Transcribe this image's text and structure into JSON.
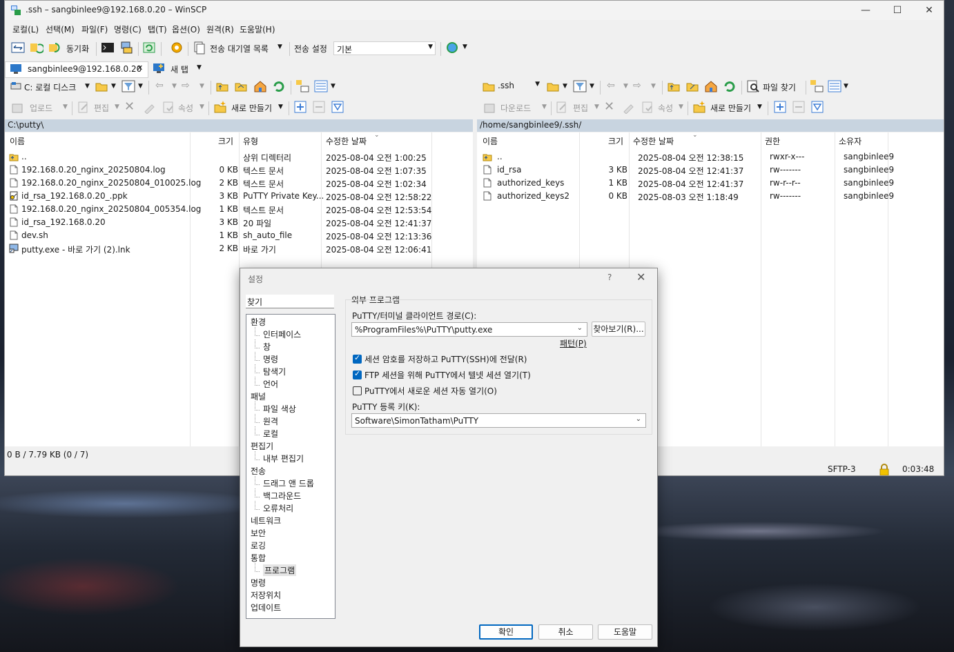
{
  "window": {
    "title": ".ssh – sangbinlee9@192.168.0.20 – WinSCP",
    "controls": {
      "minimize": "—",
      "maximize": "☐",
      "close": "✕"
    }
  },
  "menu": [
    "로컬(L)",
    "선택(M)",
    "파일(F)",
    "명령(C)",
    "탭(T)",
    "옵션(O)",
    "원격(R)",
    "도움말(H)"
  ],
  "toolbar": {
    "sync_label": "동기화",
    "queue_label": "전송 대기열 목록",
    "transfer_settings_label": "전송 설정",
    "transfer_settings_value": "기본"
  },
  "tabs": {
    "session": "sangbinlee9@192.168.0.20",
    "new_tab": "새 탭"
  },
  "local": {
    "drive": "C: 로컬 디스크",
    "upload": "업로드",
    "edit": "편집",
    "properties": "속성",
    "new": "새로 만들기",
    "path": "C:\\putty\\",
    "columns": [
      "이름",
      "크기",
      "유형",
      "수정한 날짜"
    ],
    "files": [
      {
        "name": "..",
        "size": "",
        "type": "상위 디렉터리",
        "date": "2025-08-04 오전 1:00:25",
        "icon": "folder-up-icon"
      },
      {
        "name": "192.168.0.20_nginx_20250804.log",
        "size": "0 KB",
        "type": "텍스트 문서",
        "date": "2025-08-04 오전 1:07:35",
        "icon": "file-icon"
      },
      {
        "name": "192.168.0.20_nginx_20250804_010025.log",
        "size": "2 KB",
        "type": "텍스트 문서",
        "date": "2025-08-04 오전 1:02:34",
        "icon": "file-icon"
      },
      {
        "name": "id_rsa_192.168.0.20_.ppk",
        "size": "3 KB",
        "type": "PuTTY Private Key...",
        "date": "2025-08-04 오전 12:58:22",
        "icon": "key-file-icon"
      },
      {
        "name": "192.168.0.20_nginx_20250804_005354.log",
        "size": "1 KB",
        "type": "텍스트 문서",
        "date": "2025-08-04 오전 12:53:54",
        "icon": "file-icon"
      },
      {
        "name": "id_rsa_192.168.0.20",
        "size": "3 KB",
        "type": "20 파일",
        "date": "2025-08-04 오전 12:41:37",
        "icon": "file-icon"
      },
      {
        "name": "dev.sh",
        "size": "1 KB",
        "type": "sh_auto_file",
        "date": "2025-08-04 오전 12:13:36",
        "icon": "file-icon"
      },
      {
        "name": "putty.exe - 바로 가기 (2).lnk",
        "size": "2 KB",
        "type": "바로 가기",
        "date": "2025-08-04 오전 12:06:41",
        "icon": "shortcut-icon"
      }
    ],
    "status": "0 B / 7.79 KB (0 / 7)"
  },
  "remote": {
    "dir": ".ssh",
    "download": "다운로드",
    "edit": "편집",
    "properties": "속성",
    "new": "새로 만들기",
    "find": "파일 찾기",
    "path": "/home/sangbinlee9/.ssh/",
    "columns": [
      "이름",
      "크기",
      "수정한 날짜",
      "권한",
      "소유자"
    ],
    "files": [
      {
        "name": "..",
        "size": "",
        "date": "2025-08-04 오전 12:38:15",
        "perm": "rwxr-x---",
        "owner": "sangbinlee9",
        "icon": "folder-up-icon"
      },
      {
        "name": "id_rsa",
        "size": "3 KB",
        "date": "2025-08-04 오전 12:41:37",
        "perm": "rw-------",
        "owner": "sangbinlee9",
        "icon": "file-icon"
      },
      {
        "name": "authorized_keys",
        "size": "1 KB",
        "date": "2025-08-04 오전 12:41:37",
        "perm": "rw-r--r--",
        "owner": "sangbinlee9",
        "icon": "file-icon"
      },
      {
        "name": "authorized_keys2",
        "size": "0 KB",
        "date": "2025-08-03 오전 1:18:49",
        "perm": "rw-------",
        "owner": "sangbinlee9",
        "icon": "file-icon"
      }
    ],
    "protocol": "SFTP-3",
    "elapsed": "0:03:48"
  },
  "dialog": {
    "title": "설정",
    "help_glyph": "?",
    "close_glyph": "✕",
    "search_placeholder": "찾기",
    "tree": [
      {
        "label": "환경",
        "level": 0
      },
      {
        "label": "인터페이스",
        "level": 1
      },
      {
        "label": "창",
        "level": 1
      },
      {
        "label": "명령",
        "level": 1
      },
      {
        "label": "탐색기",
        "level": 1
      },
      {
        "label": "언어",
        "level": 1
      },
      {
        "label": "패널",
        "level": 0
      },
      {
        "label": "파일 색상",
        "level": 1
      },
      {
        "label": "원격",
        "level": 1
      },
      {
        "label": "로컬",
        "level": 1
      },
      {
        "label": "편집기",
        "level": 0
      },
      {
        "label": "내부 편집기",
        "level": 1
      },
      {
        "label": "전송",
        "level": 0
      },
      {
        "label": "드래그 앤 드롭",
        "level": 1
      },
      {
        "label": "백그라운드",
        "level": 1
      },
      {
        "label": "오류처리",
        "level": 1
      },
      {
        "label": "네트워크",
        "level": 0
      },
      {
        "label": "보안",
        "level": 0
      },
      {
        "label": "로깅",
        "level": 0
      },
      {
        "label": "통합",
        "level": 0
      },
      {
        "label": "프로그램",
        "level": 1,
        "selected": true
      },
      {
        "label": "명령",
        "level": 0
      },
      {
        "label": "저장위치",
        "level": 0
      },
      {
        "label": "업데이트",
        "level": 0
      }
    ],
    "group_title": "외부 프로그램",
    "putty_path_label": "PuTTY/터미널 클라이언트 경로(C):",
    "putty_path_value": "%ProgramFiles%\\PuTTY\\putty.exe",
    "browse_label": "찾아보기(R)...",
    "patterns_label": "패턴(P)",
    "options": [
      {
        "label": "세션 암호를 저장하고 PuTTY(SSH)에 전달(R)",
        "checked": true
      },
      {
        "label": "FTP 세션을 위해 PuTTY에서 텔넷 세션 열기(T)",
        "checked": true
      },
      {
        "label": "PuTTY에서 새로운 세션 자동 열기(O)",
        "checked": false
      }
    ],
    "registry_label": "PuTTY 등록 키(K):",
    "registry_value": "Software\\SimonTatham\\PuTTY",
    "ok": "확인",
    "cancel": "취소",
    "help": "도움말"
  }
}
